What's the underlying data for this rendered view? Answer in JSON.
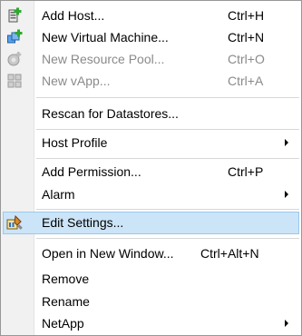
{
  "menu": {
    "items": [
      {
        "label": "Add Host...",
        "shortcut": "Ctrl+H",
        "icon": "add-host-icon"
      },
      {
        "label": "New Virtual Machine...",
        "shortcut": "Ctrl+N",
        "icon": "new-vm-icon"
      },
      {
        "label": "New Resource Pool...",
        "shortcut": "Ctrl+O",
        "icon": "resource-pool-icon",
        "disabled": true
      },
      {
        "label": "New vApp...",
        "shortcut": "Ctrl+A",
        "icon": "vapp-icon",
        "disabled": true
      },
      {
        "label": "Rescan for Datastores..."
      },
      {
        "label": "Host Profile",
        "submenu": true
      },
      {
        "label": "Add Permission...",
        "shortcut": "Ctrl+P"
      },
      {
        "label": "Alarm",
        "submenu": true
      },
      {
        "label": "Edit Settings...",
        "icon": "edit-settings-icon",
        "highlighted": true
      },
      {
        "label": "Open in New Window...",
        "shortcut": "Ctrl+Alt+N"
      },
      {
        "label": "Remove"
      },
      {
        "label": "Rename"
      },
      {
        "label": "NetApp",
        "submenu": true
      }
    ]
  },
  "colors": {
    "highlight_bg": "#cce4f7",
    "highlight_border": "#99c9ef",
    "disabled_text": "#8a8a8a",
    "icon_green": "#2fa82f",
    "icon_blue": "#2a6fc9"
  }
}
